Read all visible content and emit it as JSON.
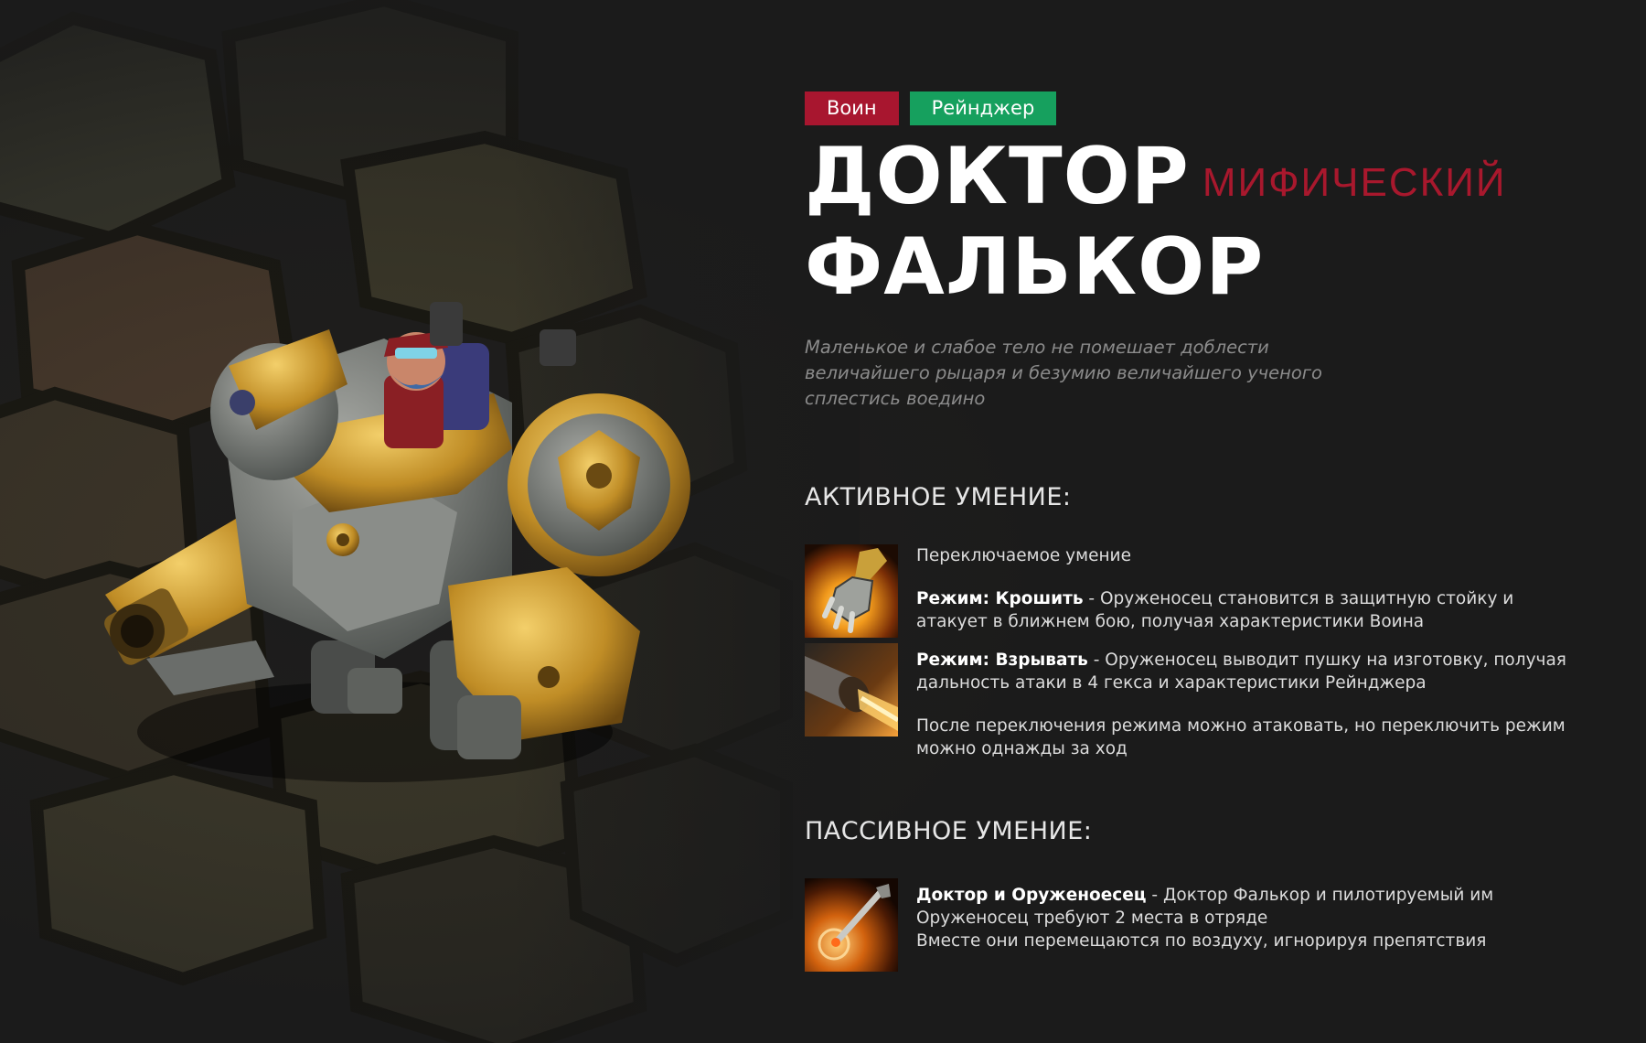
{
  "tags": [
    {
      "label": "Воин",
      "color": "#a8162f"
    },
    {
      "label": "Рейнджер",
      "color": "#16a05e"
    }
  ],
  "hero": {
    "name_line1": "ДОКТОР",
    "name_line2": "ФАЛЬКОР",
    "rarity": "МИФИЧЕСКИЙ",
    "description": "Маленькое и слабое тело не помешает доблести величайшего рыцаря и безумию величайшего ученого сплестись воедино"
  },
  "active": {
    "title": "АКТИВНОЕ УМЕНИЕ:",
    "intro": "Переключаемое умение",
    "mode1_name": "Режим: Крошить",
    "mode1_text": " - Оруженосец становится в защитную стойку и атакует в ближнем бою, получая характеристики Воина",
    "mode2_name": "Режим: Взрывать",
    "mode2_text": " - Оруженосец выводит пушку на изготовку, получая дальность атаки в 4 гекса и характеристики Рейнджера",
    "note": "После переключения режима можно атаковать, но переключить режим можно однажды за ход",
    "icon1": "gauntlet-icon",
    "icon2": "cannon-icon"
  },
  "passive": {
    "title": "ПАССИВНОЕ УМЕНИЕ:",
    "name": "Доктор и Оруженоесец",
    "text": " - Доктор Фалькор и пилотируемый им Оруженосец требуют 2 места в отряде",
    "text2": "Вместе они перемещаются по воздуху, игнорируя препятствия",
    "icon": "wrench-icon"
  },
  "colors": {
    "background": "#1b1b1b",
    "warrior_tag": "#a8162f",
    "ranger_tag": "#16a05e",
    "rarity": "#a8182d",
    "description": "#8b8b8b"
  }
}
